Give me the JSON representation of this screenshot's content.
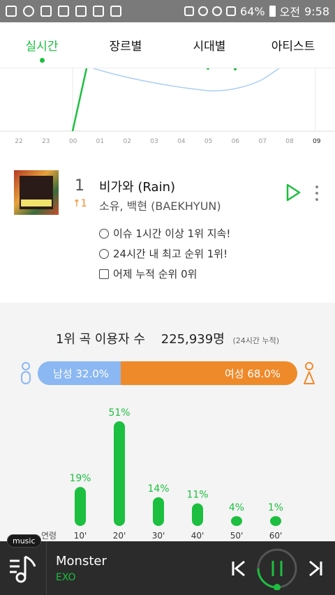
{
  "statusbar": {
    "battery": "64%",
    "ampm": "오전",
    "time": "9:58"
  },
  "tabs": [
    {
      "label": "실시간",
      "active": true
    },
    {
      "label": "장르별",
      "active": false
    },
    {
      "label": "시대별",
      "active": false
    },
    {
      "label": "아티스트",
      "active": false
    }
  ],
  "hour_chart": {
    "hours": [
      "22",
      "23",
      "00",
      "01",
      "02",
      "03",
      "04",
      "05",
      "06",
      "07",
      "08",
      "09"
    ],
    "line_color": "#1cbf3f",
    "curve_color": "#a9cff2"
  },
  "song": {
    "rank": "1",
    "rank_change": "↑1",
    "title": "비가와 (Rain)",
    "artist": "소유, 백현 (BAEKHYUN)",
    "facts": [
      "이슈 1시간 이상 1위 지속!",
      "24시간 내 최고 순위 1위!",
      "어제 누적 순위 0위"
    ],
    "play_icon": "play-icon",
    "more_icon": "more-vert-icon"
  },
  "stats": {
    "listeners_label": "1위 곡 이용자 수",
    "listeners_count": "225,939명",
    "listeners_note": "(24시간 누적)",
    "male_label": "남성 32.0%",
    "female_label": "여성 68.0%",
    "male_share": 0.32,
    "female_share": 0.68,
    "male_color": "#8bb8f2",
    "female_color": "#ef8a2a",
    "age_axis_label": "연령"
  },
  "chart_data": {
    "type": "bar",
    "categories": [
      "10'",
      "20'",
      "30'",
      "40'",
      "50'",
      "60'"
    ],
    "values": [
      19,
      51,
      14,
      11,
      4,
      1
    ],
    "value_labels": [
      "19%",
      "51%",
      "14%",
      "11%",
      "4%",
      "1%"
    ],
    "xlabel": "연령",
    "ylabel": "",
    "color": "#1cbf3f"
  },
  "player": {
    "badge": "music",
    "title": "Monster",
    "artist": "EXO",
    "progress": 0.25
  }
}
